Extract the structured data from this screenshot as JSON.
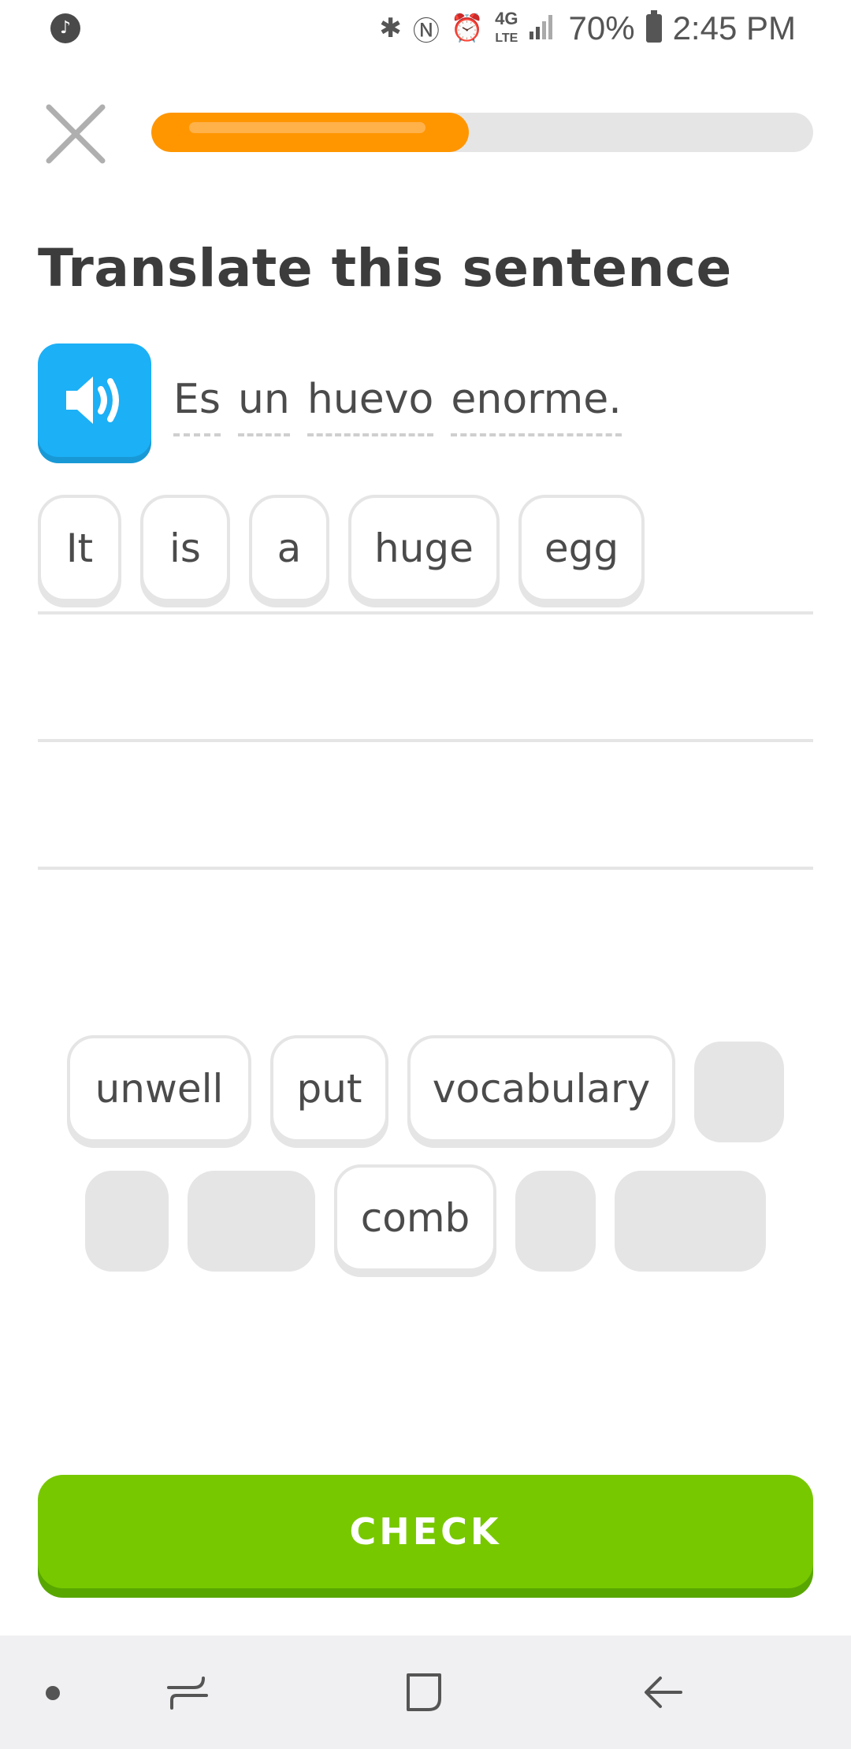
{
  "status_bar": {
    "network": "4G",
    "network_sub": "LTE",
    "battery": "70%",
    "time": "2:45 PM"
  },
  "lesson": {
    "progress_percent": 48,
    "prompt_title": "Translate this sentence",
    "source_sentence": [
      "Es",
      "un",
      "huevo",
      "enorme."
    ]
  },
  "answer": {
    "selected_words": [
      "It",
      "is",
      "a",
      "huge",
      "egg"
    ]
  },
  "word_bank": {
    "row1": [
      "unwell",
      "put",
      "vocabulary"
    ],
    "row2_word": "comb"
  },
  "actions": {
    "check_label": "CHECK"
  },
  "colors": {
    "progress_fill": "#ff9600",
    "speaker": "#1cb0f6",
    "check_button": "#78c800"
  },
  "icons": [
    "music-note-icon",
    "bluetooth-icon",
    "nfc-icon",
    "alarm-icon",
    "signal-icon",
    "battery-icon",
    "close-icon",
    "speaker-icon",
    "recent-apps-icon",
    "home-icon",
    "back-icon"
  ]
}
